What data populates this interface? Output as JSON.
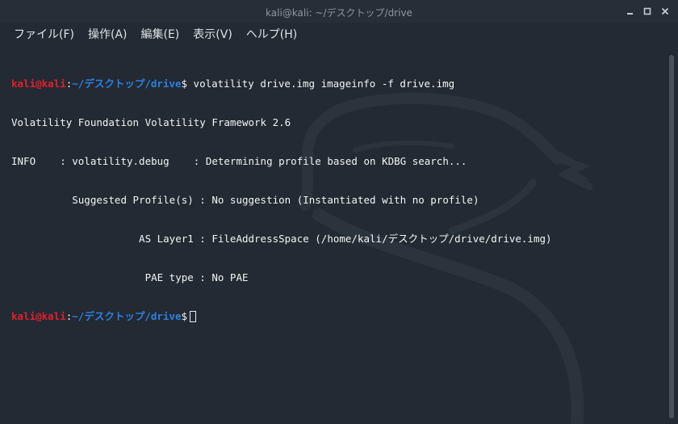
{
  "window": {
    "title": "kali@kali: ~/デスクトップ/drive"
  },
  "window_controls": {
    "minimize_icon": "minimize-icon",
    "maximize_icon": "maximize-icon",
    "close_icon": "close-icon"
  },
  "menu": {
    "items": [
      {
        "label": "ファイル(F)"
      },
      {
        "label": "操作(A)"
      },
      {
        "label": "編集(E)"
      },
      {
        "label": "表示(V)"
      },
      {
        "label": "ヘルプ(H)"
      }
    ]
  },
  "terminal": {
    "lines": [
      {
        "user": "kali@kali",
        "sep": ":",
        "path": "~/デスクトップ/drive",
        "dollar": "$",
        "command": " volatility drive.img imageinfo -f drive.img"
      },
      {
        "text": "Volatility Foundation Volatility Framework 2.6"
      },
      {
        "text": "INFO    : volatility.debug    : Determining profile based on KDBG search..."
      },
      {
        "text": "          Suggested Profile(s) : No suggestion (Instantiated with no profile)"
      },
      {
        "text": "                     AS Layer1 : FileAddressSpace (/home/kali/デスクトップ/drive/drive.img)"
      },
      {
        "text": "                      PAE type : No PAE"
      },
      {
        "user": "kali@kali",
        "sep": ":",
        "path": "~/デスクトップ/drive",
        "dollar": "$",
        "command": ""
      }
    ]
  },
  "colors": {
    "background": "#232a33",
    "prompt_user": "#e0202c",
    "prompt_path": "#2f7fe0",
    "text": "#f2f4f6"
  },
  "background_decoration": "kali-dragon-watermark"
}
